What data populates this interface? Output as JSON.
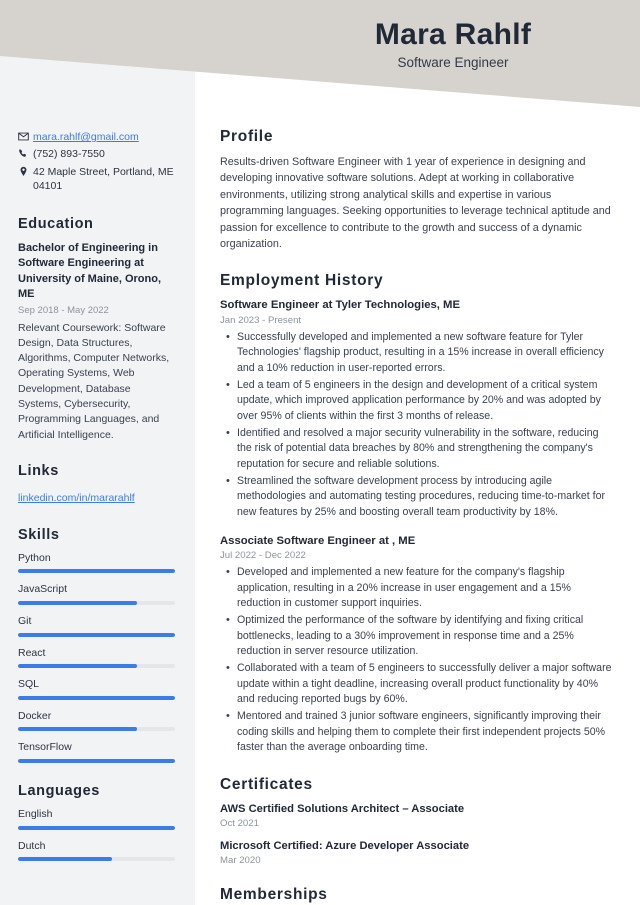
{
  "header": {
    "name": "Mara Rahlf",
    "title": "Software Engineer",
    "band_color": "#d6d2cd"
  },
  "theme": {
    "accent": "#3b7ce8",
    "sidebar_bg": "#f2f3f5",
    "heading_color": "#222936",
    "muted_color": "#8d939e",
    "track_color": "#e4e6ea"
  },
  "sidebar": {
    "contact": [
      {
        "icon": "envelope-icon",
        "value": "mara.rahlf@gmail.com",
        "is_link": true
      },
      {
        "icon": "phone-icon",
        "value": "(752) 893-7550",
        "is_link": false
      },
      {
        "icon": "location-pin-icon",
        "value": "42 Maple Street, Portland, ME 04101",
        "is_link": false
      }
    ],
    "education": {
      "heading": "Education",
      "entries": [
        {
          "title": "Bachelor of Engineering in Software Engineering at University of Maine, Orono, ME",
          "date": "Sep 2018 - May 2022",
          "description": "Relevant Coursework: Software Design, Data Structures, Algorithms, Computer Networks, Operating Systems, Web Development, Database Systems, Cybersecurity, Programming Languages, and Artificial Intelligence."
        }
      ]
    },
    "links": {
      "heading": "Links",
      "items": [
        {
          "label": "linkedin.com/in/mararahlf"
        }
      ]
    },
    "skills": {
      "heading": "Skills",
      "items": [
        {
          "label": "Python",
          "level": 100
        },
        {
          "label": "JavaScript",
          "level": 76
        },
        {
          "label": "Git",
          "level": 100
        },
        {
          "label": "React",
          "level": 76
        },
        {
          "label": "SQL",
          "level": 100
        },
        {
          "label": "Docker",
          "level": 76
        },
        {
          "label": "TensorFlow",
          "level": 100
        }
      ]
    },
    "languages": {
      "heading": "Languages",
      "items": [
        {
          "label": "English",
          "level": 100
        },
        {
          "label": "Dutch",
          "level": 60
        }
      ]
    }
  },
  "main": {
    "profile": {
      "heading": "Profile",
      "text": "Results-driven Software Engineer with 1 year of experience in designing and developing innovative software solutions. Adept at working in collaborative environments, utilizing strong analytical skills and expertise in various programming languages. Seeking opportunities to leverage technical aptitude and passion for excellence to contribute to the growth and success of a dynamic organization."
    },
    "employment": {
      "heading": "Employment History",
      "jobs": [
        {
          "title": "Software Engineer at Tyler Technologies, ME",
          "date": "Jan 2023 - Present",
          "bullets": [
            "Successfully developed and implemented a new software feature for Tyler Technologies' flagship product, resulting in a 15% increase in overall efficiency and a 10% reduction in user-reported errors.",
            "Led a team of 5 engineers in the design and development of a critical system update, which improved application performance by 20% and was adopted by over 95% of clients within the first 3 months of release.",
            "Identified and resolved a major security vulnerability in the software, reducing the risk of potential data breaches by 80% and strengthening the company's reputation for secure and reliable solutions.",
            "Streamlined the software development process by introducing agile methodologies and automating testing procedures, reducing time-to-market for new features by 25% and boosting overall team productivity by 18%."
          ]
        },
        {
          "title": "Associate Software Engineer at , ME",
          "date": "Jul 2022 - Dec 2022",
          "bullets": [
            "Developed and implemented a new feature for the company's flagship application, resulting in a 20% increase in user engagement and a 15% reduction in customer support inquiries.",
            "Optimized the performance of the software by identifying and fixing critical bottlenecks, leading to a 30% improvement in response time and a 25% reduction in server resource utilization.",
            "Collaborated with a team of 5 engineers to successfully deliver a major software update within a tight deadline, increasing overall product functionality by 40% and reducing reported bugs by 60%.",
            "Mentored and trained 3 junior software engineers, significantly improving their coding skills and helping them to complete their first independent projects 50% faster than the average onboarding time."
          ]
        }
      ]
    },
    "certificates": {
      "heading": "Certificates",
      "items": [
        {
          "title": "AWS Certified Solutions Architect – Associate",
          "date": "Oct 2021"
        },
        {
          "title": "Microsoft Certified: Azure Developer Associate",
          "date": "Mar 2020"
        }
      ]
    },
    "memberships": {
      "heading": "Memberships",
      "items": []
    }
  }
}
